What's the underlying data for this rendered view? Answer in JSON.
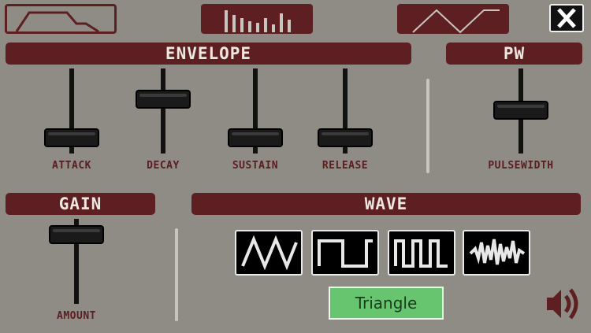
{
  "header": {
    "close_label": "X"
  },
  "envelope": {
    "title": "ENVELOPE",
    "sliders": [
      {
        "label": "ATTACK",
        "value": 0.15
      },
      {
        "label": "DECAY",
        "value": 0.65
      },
      {
        "label": "SUSTAIN",
        "value": 0.15
      },
      {
        "label": "RELEASE",
        "value": 0.15
      }
    ]
  },
  "pw": {
    "title": "PW",
    "slider_label": "PULSEWIDTH",
    "value": 0.5
  },
  "gain": {
    "title": "GAIN",
    "slider_label": "AMOUNT",
    "value": 0.85
  },
  "wave": {
    "title": "WAVE",
    "options": [
      "triangle-wave-icon",
      "square-wave-icon",
      "pulse-wave-icon",
      "noise-wave-icon"
    ],
    "selected_label": "Triangle"
  },
  "colors": {
    "accent": "#5e1f23",
    "background": "#8f8c86",
    "selected": "#67c56f"
  }
}
